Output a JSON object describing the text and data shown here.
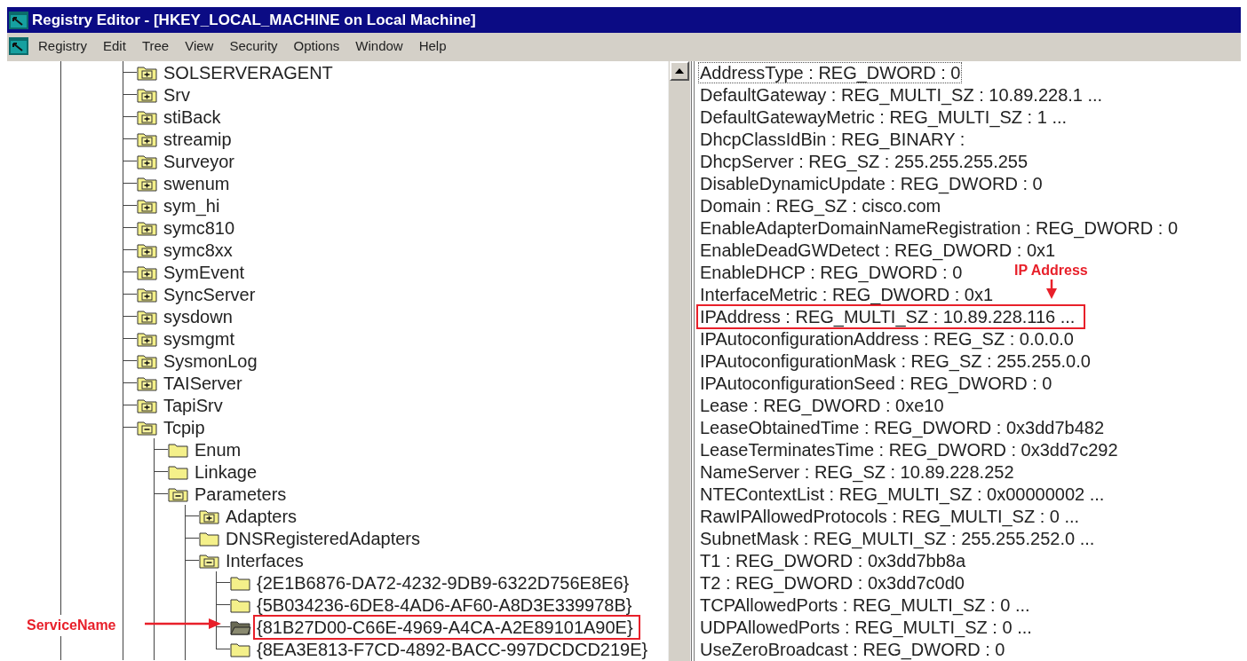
{
  "window": {
    "title": "Registry Editor - [HKEY_LOCAL_MACHINE on Local Machine]"
  },
  "menu": [
    "Registry",
    "Edit",
    "Tree",
    "View",
    "Security",
    "Options",
    "Window",
    "Help"
  ],
  "tree": {
    "items": [
      {
        "label": "SOLSERVERAGENT",
        "kind": "node",
        "expanded": false,
        "selected": false,
        "highlighted": false
      },
      {
        "label": "Srv",
        "kind": "node",
        "expanded": false,
        "selected": false,
        "highlighted": false
      },
      {
        "label": "stiBack",
        "kind": "node",
        "expanded": false,
        "selected": false,
        "highlighted": false
      },
      {
        "label": "streamip",
        "kind": "node",
        "expanded": false,
        "selected": false,
        "highlighted": false
      },
      {
        "label": "Surveyor",
        "kind": "node",
        "expanded": false,
        "selected": false,
        "highlighted": false
      },
      {
        "label": "swenum",
        "kind": "node",
        "expanded": false,
        "selected": false,
        "highlighted": false
      },
      {
        "label": "sym_hi",
        "kind": "node",
        "expanded": false,
        "selected": false,
        "highlighted": false
      },
      {
        "label": "symc810",
        "kind": "node",
        "expanded": false,
        "selected": false,
        "highlighted": false
      },
      {
        "label": "symc8xx",
        "kind": "node",
        "expanded": false,
        "selected": false,
        "highlighted": false
      },
      {
        "label": "SymEvent",
        "kind": "node",
        "expanded": false,
        "selected": false,
        "highlighted": false
      },
      {
        "label": "SyncServer",
        "kind": "node",
        "expanded": false,
        "selected": false,
        "highlighted": false
      },
      {
        "label": "sysdown",
        "kind": "node",
        "expanded": false,
        "selected": false,
        "highlighted": false
      },
      {
        "label": "sysmgmt",
        "kind": "node",
        "expanded": false,
        "selected": false,
        "highlighted": false
      },
      {
        "label": "SysmonLog",
        "kind": "node",
        "expanded": false,
        "selected": false,
        "highlighted": false
      },
      {
        "label": "TAIServer",
        "kind": "node",
        "expanded": false,
        "selected": false,
        "highlighted": false
      },
      {
        "label": "TapiSrv",
        "kind": "node",
        "expanded": false,
        "selected": false,
        "highlighted": false
      },
      {
        "label": "Tcpip",
        "kind": "node",
        "expanded": true,
        "selected": false,
        "highlighted": false,
        "children": [
          {
            "label": "Enum",
            "kind": "leaf",
            "expanded": false,
            "selected": false,
            "highlighted": false
          },
          {
            "label": "Linkage",
            "kind": "leaf",
            "expanded": false,
            "selected": false,
            "highlighted": false
          },
          {
            "label": "Parameters",
            "kind": "node",
            "expanded": true,
            "selected": false,
            "highlighted": false,
            "children": [
              {
                "label": "Adapters",
                "kind": "node",
                "expanded": false,
                "selected": false,
                "highlighted": false
              },
              {
                "label": "DNSRegisteredAdapters",
                "kind": "leaf",
                "expanded": false,
                "selected": false,
                "highlighted": false
              },
              {
                "label": "Interfaces",
                "kind": "node",
                "expanded": true,
                "selected": false,
                "highlighted": false,
                "children": [
                  {
                    "label": "{2E1B6876-DA72-4232-9DB9-6322D756E8E6}",
                    "kind": "leaf",
                    "expanded": false,
                    "selected": false,
                    "highlighted": false
                  },
                  {
                    "label": "{5B034236-6DE8-4AD6-AF60-A8D3E339978B}",
                    "kind": "leaf",
                    "expanded": false,
                    "selected": false,
                    "highlighted": false
                  },
                  {
                    "label": "{81B27D00-C66E-4969-A4CA-A2E89101A90E}",
                    "kind": "leaf",
                    "expanded": false,
                    "selected": true,
                    "highlighted": true
                  },
                  {
                    "label": "{8EA3E813-F7CD-4892-BACC-997DCDCD219E}",
                    "kind": "leaf",
                    "expanded": false,
                    "selected": false,
                    "highlighted": false
                  }
                ]
              }
            ]
          }
        ]
      }
    ]
  },
  "values": [
    {
      "text": "AddressType : REG_DWORD : 0",
      "focused": true,
      "highlighted": false
    },
    {
      "text": "DefaultGateway : REG_MULTI_SZ : 10.89.228.1 ...",
      "focused": false,
      "highlighted": false
    },
    {
      "text": "DefaultGatewayMetric : REG_MULTI_SZ : 1 ...",
      "focused": false,
      "highlighted": false
    },
    {
      "text": "DhcpClassIdBin : REG_BINARY :",
      "focused": false,
      "highlighted": false
    },
    {
      "text": "DhcpServer : REG_SZ : 255.255.255.255",
      "focused": false,
      "highlighted": false
    },
    {
      "text": "DisableDynamicUpdate : REG_DWORD : 0",
      "focused": false,
      "highlighted": false
    },
    {
      "text": "Domain : REG_SZ : cisco.com",
      "focused": false,
      "highlighted": false
    },
    {
      "text": "EnableAdapterDomainNameRegistration : REG_DWORD : 0",
      "focused": false,
      "highlighted": false
    },
    {
      "text": "EnableDeadGWDetect : REG_DWORD : 0x1",
      "focused": false,
      "highlighted": false
    },
    {
      "text": "EnableDHCP : REG_DWORD : 0",
      "focused": false,
      "highlighted": false
    },
    {
      "text": "InterfaceMetric : REG_DWORD : 0x1",
      "focused": false,
      "highlighted": false
    },
    {
      "text": "IPAddress : REG_MULTI_SZ : 10.89.228.116 ...",
      "focused": false,
      "highlighted": true
    },
    {
      "text": "IPAutoconfigurationAddress : REG_SZ : 0.0.0.0",
      "focused": false,
      "highlighted": false
    },
    {
      "text": "IPAutoconfigurationMask : REG_SZ : 255.255.0.0",
      "focused": false,
      "highlighted": false
    },
    {
      "text": "IPAutoconfigurationSeed : REG_DWORD : 0",
      "focused": false,
      "highlighted": false
    },
    {
      "text": "Lease : REG_DWORD : 0xe10",
      "focused": false,
      "highlighted": false
    },
    {
      "text": "LeaseObtainedTime : REG_DWORD : 0x3dd7b482",
      "focused": false,
      "highlighted": false
    },
    {
      "text": "LeaseTerminatesTime : REG_DWORD : 0x3dd7c292",
      "focused": false,
      "highlighted": false
    },
    {
      "text": "NameServer : REG_SZ : 10.89.228.252",
      "focused": false,
      "highlighted": false
    },
    {
      "text": "NTEContextList : REG_MULTI_SZ : 0x00000002 ...",
      "focused": false,
      "highlighted": false
    },
    {
      "text": "RawIPAllowedProtocols : REG_MULTI_SZ : 0 ...",
      "focused": false,
      "highlighted": false
    },
    {
      "text": "SubnetMask : REG_MULTI_SZ : 255.255.252.0 ...",
      "focused": false,
      "highlighted": false
    },
    {
      "text": "T1 : REG_DWORD : 0x3dd7bb8a",
      "focused": false,
      "highlighted": false
    },
    {
      "text": "T2 : REG_DWORD : 0x3dd7c0d0",
      "focused": false,
      "highlighted": false
    },
    {
      "text": "TCPAllowedPorts : REG_MULTI_SZ : 0 ...",
      "focused": false,
      "highlighted": false
    },
    {
      "text": "UDPAllowedPorts : REG_MULTI_SZ : 0 ...",
      "focused": false,
      "highlighted": false
    },
    {
      "text": "UseZeroBroadcast : REG_DWORD : 0",
      "focused": false,
      "highlighted": false
    }
  ],
  "annotations": {
    "ip_label": "IP Address",
    "service_label": "ServiceName"
  }
}
